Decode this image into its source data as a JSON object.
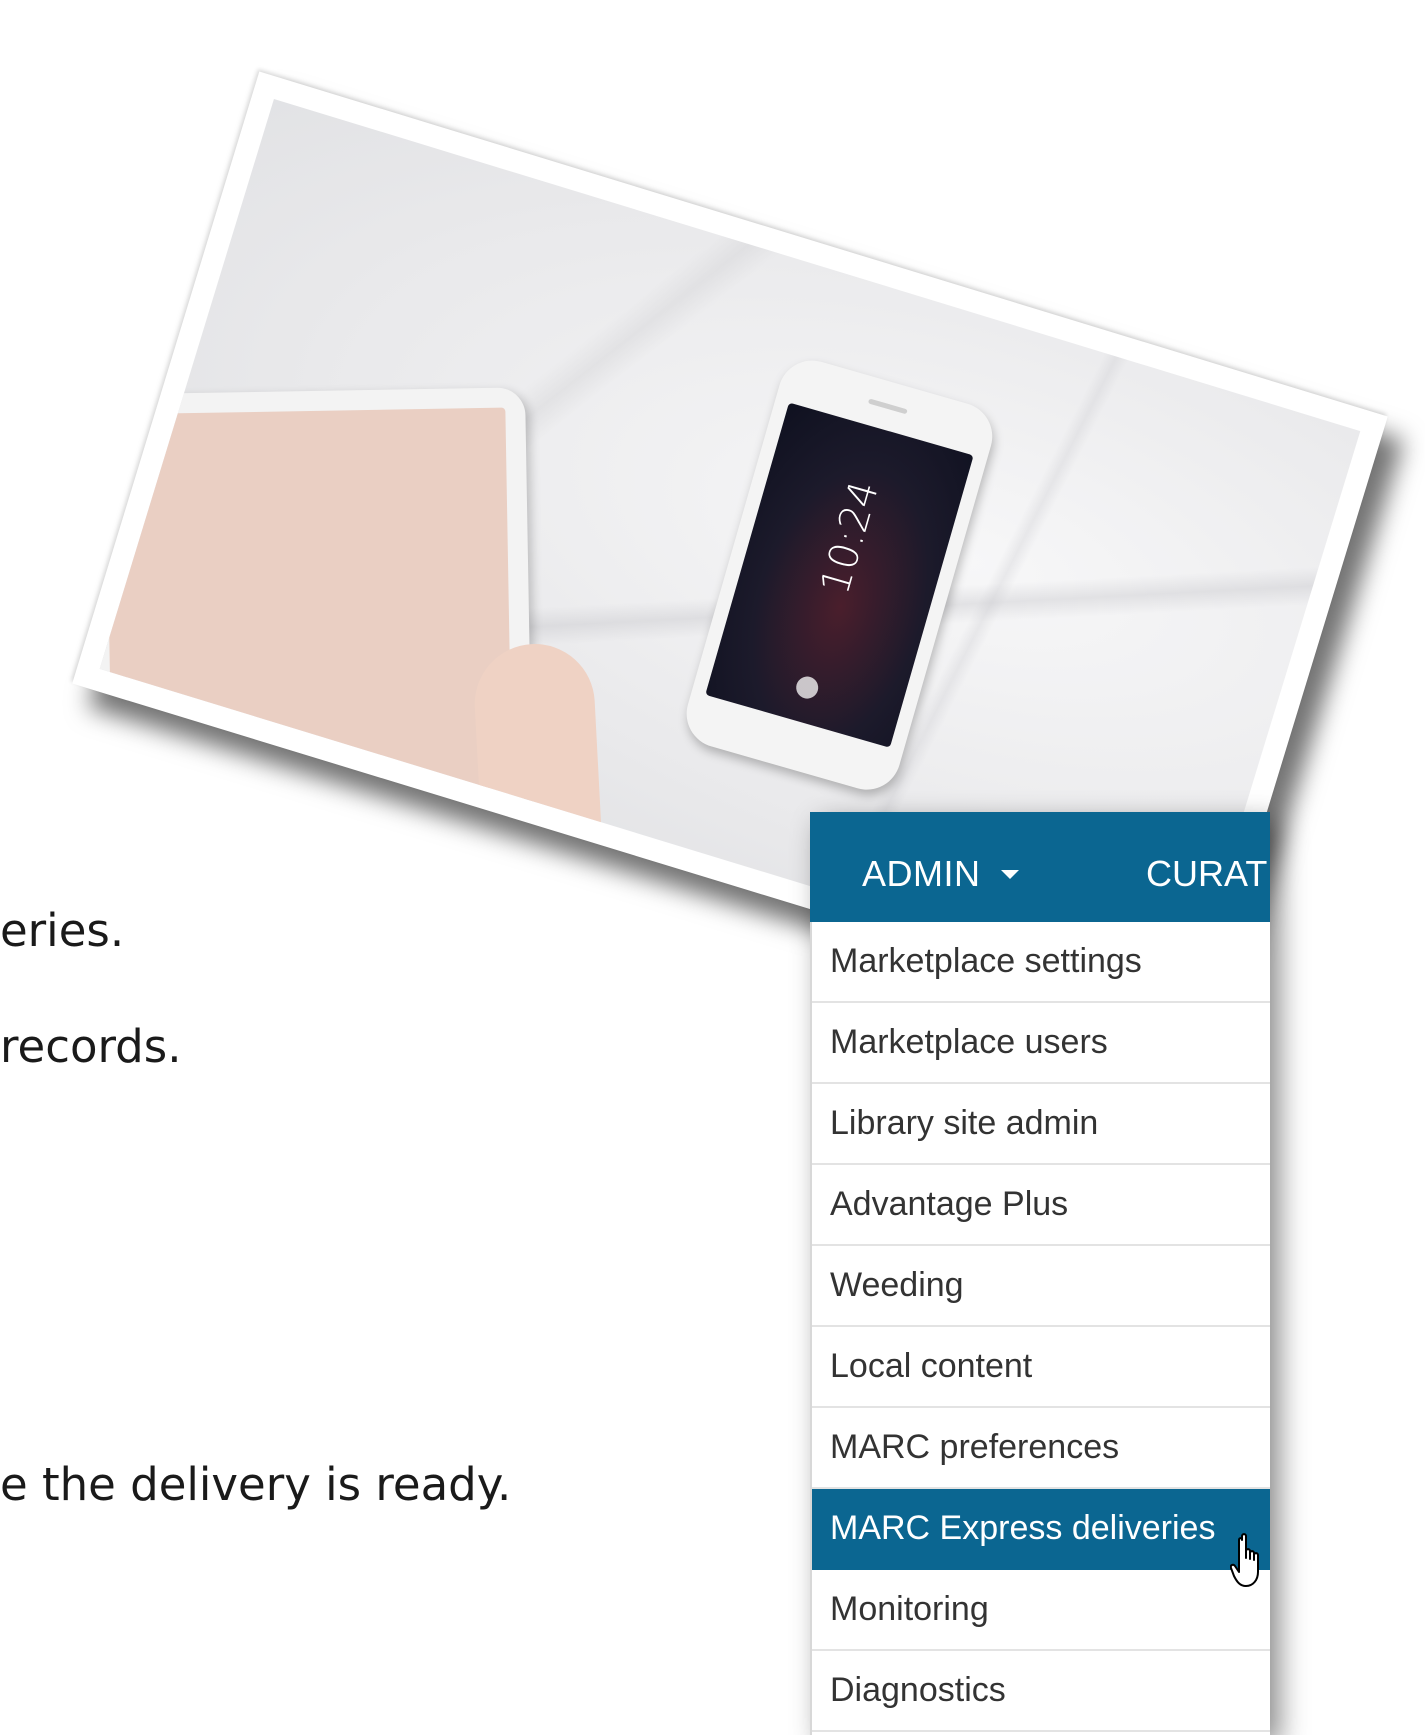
{
  "slide": {
    "line1": "eries.",
    "line2": "records.",
    "line3": "e the delivery is ready."
  },
  "photo": {
    "phone_time": "10:24"
  },
  "admin_menu": {
    "header_label": "ADMIN",
    "next_nav_label": "CURAT",
    "accent_color": "#0b6691",
    "items": [
      {
        "label": "Marketplace settings"
      },
      {
        "label": "Marketplace users"
      },
      {
        "label": "Library site admin"
      },
      {
        "label": "Advantage Plus"
      },
      {
        "label": "Weeding"
      },
      {
        "label": "Local content"
      },
      {
        "label": "MARC preferences"
      },
      {
        "label": "MARC Express deliveries",
        "selected": true
      },
      {
        "label": "Monitoring"
      },
      {
        "label": "Diagnostics"
      }
    ],
    "icons": {
      "dropdown": "caret-down-icon",
      "pointer": "hand-cursor-icon"
    }
  }
}
